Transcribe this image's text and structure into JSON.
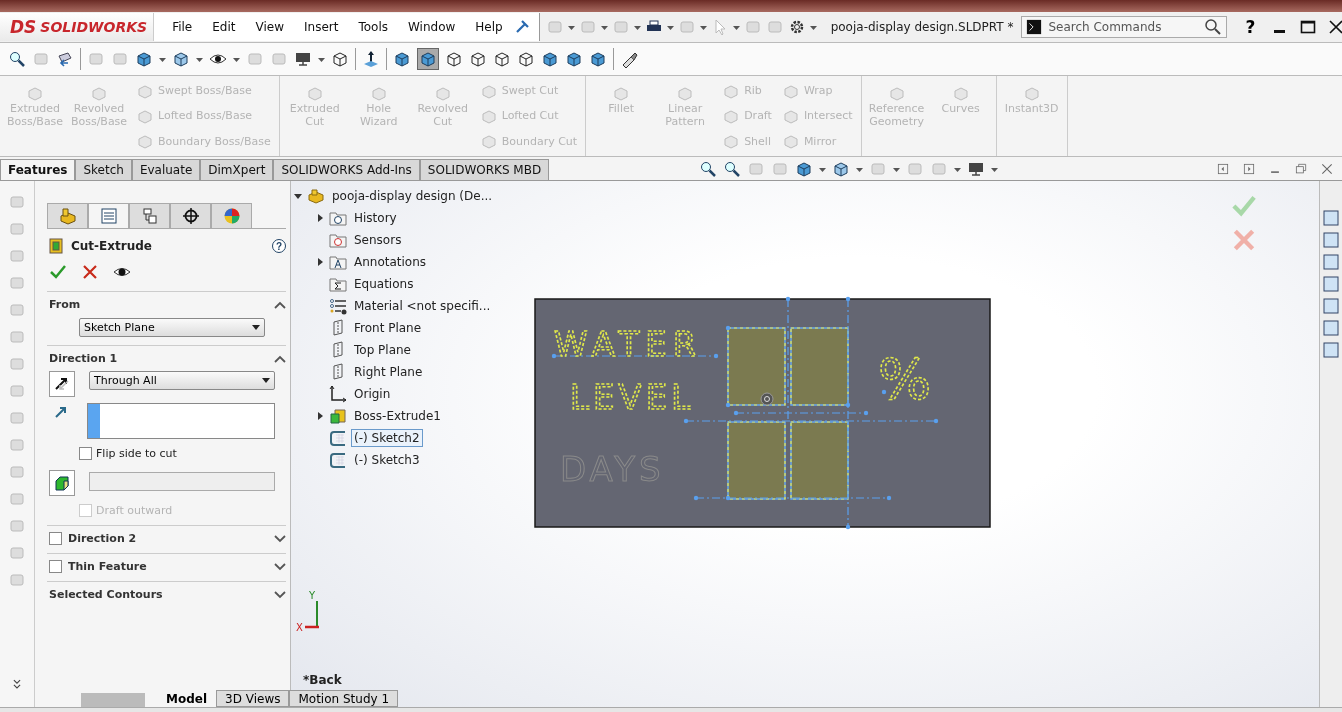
{
  "title_bar": {
    "logo_mark": "DS",
    "logo": "SOLIDWORKS",
    "menu": [
      "File",
      "Edit",
      "View",
      "Insert",
      "Tools",
      "Window",
      "Help"
    ],
    "document_title": "pooja-display design.SLDPRT *",
    "search": {
      "placeholder": "Search Commands"
    },
    "help": "?"
  },
  "ribbon": {
    "groups": [
      {
        "commands": [
          {
            "label": "Extruded Boss/Base",
            "kind": "large",
            "disabled": true
          },
          {
            "label": "Revolved Boss/Base",
            "kind": "large",
            "disabled": true
          },
          {
            "label": "Swept Boss/Base",
            "kind": "small",
            "disabled": true
          },
          {
            "label": "Lofted Boss/Base",
            "kind": "small",
            "disabled": true
          },
          {
            "label": "Boundary Boss/Base",
            "kind": "small",
            "disabled": true
          }
        ]
      },
      {
        "commands": [
          {
            "label": "Extruded Cut",
            "kind": "large",
            "disabled": true
          },
          {
            "label": "Hole Wizard",
            "kind": "large",
            "disabled": true
          },
          {
            "label": "Revolved Cut",
            "kind": "large",
            "disabled": true
          },
          {
            "label": "Swept Cut",
            "kind": "small",
            "disabled": true
          },
          {
            "label": "Lofted Cut",
            "kind": "small",
            "disabled": true
          },
          {
            "label": "Boundary Cut",
            "kind": "small",
            "disabled": true
          }
        ]
      },
      {
        "commands": [
          {
            "label": "Fillet",
            "kind": "large",
            "disabled": true
          },
          {
            "label": "Linear Pattern",
            "kind": "large",
            "disabled": true
          },
          {
            "label": "Rib",
            "kind": "small",
            "disabled": true
          },
          {
            "label": "Draft",
            "kind": "small",
            "disabled": true
          },
          {
            "label": "Shell",
            "kind": "small",
            "disabled": true
          },
          {
            "label": "Wrap",
            "kind": "small",
            "disabled": true
          },
          {
            "label": "Intersect",
            "kind": "small",
            "disabled": true
          },
          {
            "label": "Mirror",
            "kind": "small",
            "disabled": true
          }
        ]
      },
      {
        "commands": [
          {
            "label": "Reference Geometry",
            "kind": "large",
            "disabled": true
          },
          {
            "label": "Curves",
            "kind": "large",
            "disabled": true
          }
        ]
      },
      {
        "commands": [
          {
            "label": "Instant3D",
            "kind": "large",
            "disabled": true
          }
        ]
      }
    ]
  },
  "tabs": [
    {
      "label": "Features",
      "selected": true
    },
    {
      "label": "Sketch",
      "selected": false
    },
    {
      "label": "Evaluate",
      "selected": false
    },
    {
      "label": "DimXpert",
      "selected": false
    },
    {
      "label": "SOLIDWORKS Add-Ins",
      "selected": false
    },
    {
      "label": "SOLIDWORKS MBD",
      "selected": false
    }
  ],
  "property_manager": {
    "panel_tabs": [
      {
        "kind": "feature",
        "selected": false
      },
      {
        "kind": "property",
        "selected": true
      },
      {
        "kind": "config",
        "selected": false
      },
      {
        "kind": "dimxpert",
        "selected": false
      },
      {
        "kind": "display",
        "selected": false
      }
    ],
    "title": "Cut-Extrude",
    "help": "?",
    "sections": [
      {
        "kind": "dropdown",
        "title": "From",
        "expanded": true,
        "value": "Sketch Plane"
      },
      {
        "kind": "direction",
        "title": "Direction 1",
        "expanded": true,
        "value": "Through All",
        "flip": {
          "label": "Flip side to cut",
          "checked": false
        },
        "draft": {
          "label": "Draft outward",
          "checked": false,
          "disabled": true
        }
      },
      {
        "kind": "optional",
        "title": "Direction 2",
        "checked": false,
        "expanded": false
      },
      {
        "kind": "optional",
        "title": "Thin Feature",
        "checked": false,
        "expanded": false
      },
      {
        "kind": "plain",
        "title": "Selected Contours",
        "expanded": false
      }
    ]
  },
  "feature_tree": {
    "root": {
      "label": "pooja-display design  (De...",
      "expanded": true,
      "children": [
        {
          "label": "History",
          "kind": "history",
          "expanded": false,
          "selected": false
        },
        {
          "label": "Sensors",
          "kind": "sensors",
          "selected": false
        },
        {
          "label": "Annotations",
          "kind": "annotations",
          "expanded": false,
          "selected": false
        },
        {
          "label": "Equations",
          "kind": "equations",
          "selected": false
        },
        {
          "label": "Material <not specifi...",
          "kind": "material",
          "selected": false
        },
        {
          "label": "Front Plane",
          "kind": "plane",
          "selected": false
        },
        {
          "label": "Top Plane",
          "kind": "plane",
          "selected": false
        },
        {
          "label": "Right Plane",
          "kind": "plane",
          "selected": false
        },
        {
          "label": "Origin",
          "kind": "origin",
          "selected": false
        },
        {
          "label": "Boss-Extrude1",
          "kind": "feature",
          "expanded": false,
          "selected": false
        },
        {
          "label": "(-) Sketch2",
          "kind": "sketch",
          "selected": true
        },
        {
          "label": "(-) Sketch3",
          "kind": "sketch",
          "selected": false
        }
      ]
    }
  },
  "sketch": {
    "texts": [
      {
        "text": "WATER",
        "kind": "active"
      },
      {
        "text": "LEVEL",
        "kind": "active"
      },
      {
        "text": "%",
        "kind": "active"
      },
      {
        "text": "DAYS",
        "kind": "inactive"
      }
    ]
  },
  "triad": {
    "y": "Y",
    "x": "X"
  },
  "view_label": "*Back",
  "bottom_tabs": [
    {
      "label": "Model",
      "selected": true
    },
    {
      "label": "3D Views",
      "selected": false
    },
    {
      "label": "Motion Study 1",
      "selected": false
    }
  ]
}
